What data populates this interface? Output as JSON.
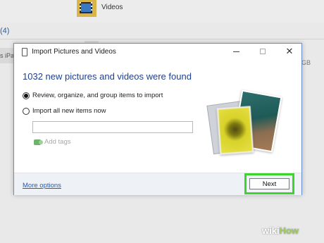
{
  "background": {
    "folder_label": "Videos",
    "devices_header": "(4)",
    "device_label_fragment": "s iPa",
    "capacity_fragment": "GB"
  },
  "dialog": {
    "title": "Import Pictures and Videos",
    "heading": "1032 new pictures and videos were found",
    "options": [
      {
        "label": "Review, organize, and group items to import",
        "selected": true
      },
      {
        "label": "Import all new items now",
        "selected": false
      }
    ],
    "name_input": {
      "value": "",
      "placeholder": ""
    },
    "add_tags_label": "Add tags",
    "footer": {
      "more_options_label": "More options",
      "next_label": "Next"
    },
    "window_controls": {
      "close_glyph": "✕"
    }
  },
  "watermark": {
    "part1": "wiki",
    "part2": "How"
  },
  "colors": {
    "heading": "#1e3f8f",
    "link": "#2a5ab0",
    "highlight": "#3dd430",
    "footer_bg": "#eef1f6"
  }
}
